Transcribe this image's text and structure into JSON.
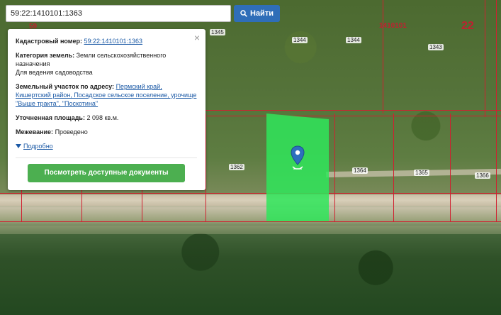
{
  "search": {
    "value": "59:22:1410101:1363",
    "button_label": "Найти"
  },
  "map": {
    "parcel_numbers": [
      "1345",
      "1344",
      "1344",
      "1343",
      "1362",
      "1364",
      "1365",
      "1366"
    ],
    "quarter_labels": [
      "59",
      "1410101",
      "22"
    ],
    "highlight_color": "#2fe65a"
  },
  "popup": {
    "close_label": "×",
    "cadastral_label": "Кадастровый номер:",
    "cadastral_value": "59:22:1410101:1363",
    "category_label": "Категория земель:",
    "category_value": "Земли сельскохозяйственного назначения",
    "usage_value": "Для ведения садоводства",
    "address_label": "Земельный участок по адресу:",
    "address_value": "Пермский край, Кишертский район, Посадское сельское поселение, урочище \"Выше тракта\", \"Поскотина\"",
    "area_label": "Уточненная площадь:",
    "area_value": "2 098 кв.м.",
    "survey_label": "Межевание:",
    "survey_value": "Проведено",
    "more_label": "Подробно",
    "docs_button": "Посмотреть доступные документы"
  },
  "colors": {
    "accent": "#2f6eb8",
    "button_green": "#4caf50",
    "link": "#1c5aa6",
    "boundary": "#d02030"
  }
}
